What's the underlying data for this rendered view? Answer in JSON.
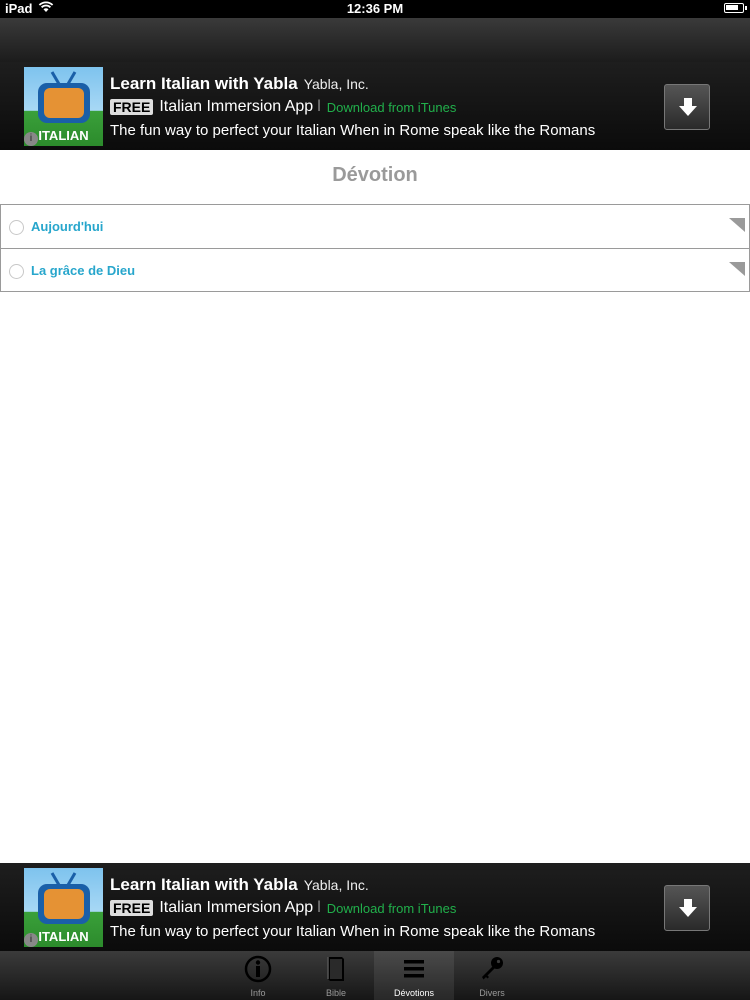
{
  "status_bar": {
    "device": "iPad",
    "time": "12:36 PM"
  },
  "ad": {
    "icon_label": "ITALIAN",
    "info_glyph": "i",
    "title": "Learn Italian with Yabla",
    "company": "Yabla, Inc.",
    "price_badge": "FREE",
    "app_type": "Italian Immersion App",
    "separator": "l",
    "download_link": "Download from iTunes",
    "tagline": "The fun way to perfect your Italian When in Rome speak like the Romans"
  },
  "page": {
    "title": "Dévotion"
  },
  "list": {
    "items": [
      {
        "label": "Aujourd'hui"
      },
      {
        "label": "La grâce de Dieu"
      }
    ]
  },
  "tab_bar": {
    "tabs": [
      {
        "label": "Info",
        "icon": "info-icon"
      },
      {
        "label": "Bible",
        "icon": "book-icon"
      },
      {
        "label": "Dévotions",
        "icon": "list-icon",
        "selected": true
      },
      {
        "label": "Divers",
        "icon": "key-icon"
      }
    ]
  },
  "colors": {
    "link_blue": "#27a6cc",
    "title_gray": "#9a9a9a",
    "download_green": "#21b04b"
  }
}
